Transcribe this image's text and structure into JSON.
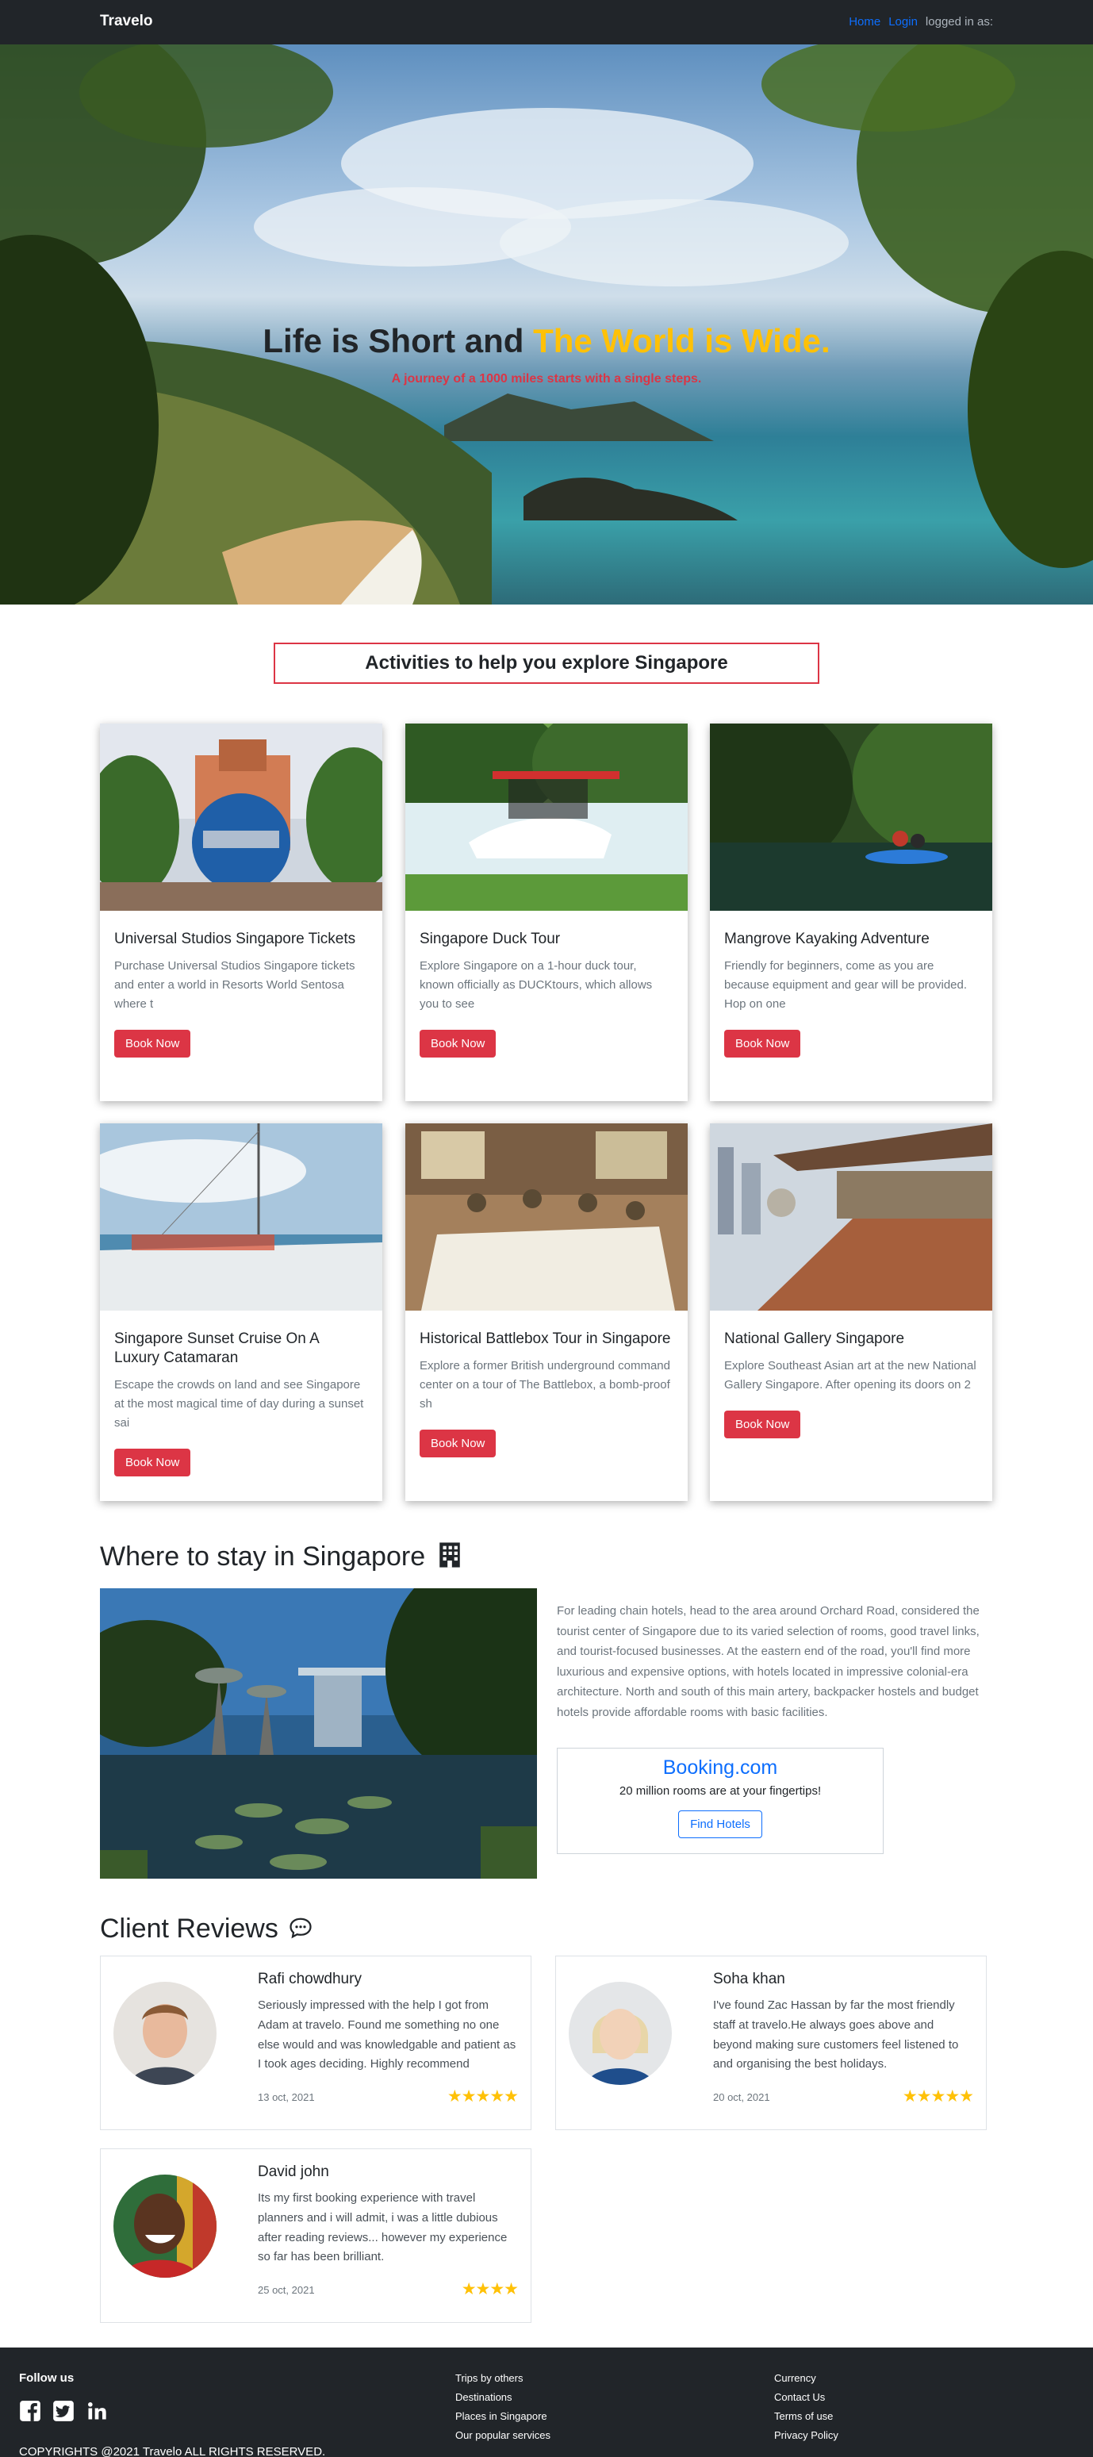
{
  "nav": {
    "brand": "Travelo",
    "links": [
      "Home",
      "Login"
    ],
    "status": "logged in as:"
  },
  "hero": {
    "title_part1": "Life is Short and ",
    "title_part2": "The World is Wide.",
    "subtitle": "A journey of a 1000 miles starts with a single steps."
  },
  "activities": {
    "heading": "Activities to help you explore Singapore",
    "cards": [
      {
        "title": "Universal Studios Singapore Tickets",
        "text": "Purchase Universal Studios Singapore tickets and enter a world in Resorts World Sentosa where t",
        "button": "Book Now",
        "image": "universal-globe"
      },
      {
        "title": "Singapore Duck Tour",
        "text": "Explore Singapore on a 1-hour duck tour, known officially as DUCKtours, which allows you to see",
        "button": "Book Now",
        "image": "duck-boat"
      },
      {
        "title": "Mangrove Kayaking Adventure",
        "text": "Friendly for beginners, come as you are because equipment and gear will be provided. Hop on one",
        "button": "Book Now",
        "image": "kayak"
      },
      {
        "title": "Singapore Sunset Cruise On A Luxury Catamaran",
        "text": "Escape the crowds on land and see Singapore at the most magical time of day during a sunset sai",
        "button": "Book Now",
        "image": "catamaran"
      },
      {
        "title": "Historical Battlebox Tour in Singapore",
        "text": "Explore a former British underground command center on a tour of The Battlebox, a bomb-proof sh",
        "button": "Book Now",
        "image": "battlebox"
      },
      {
        "title": "National Gallery Singapore",
        "text": "Explore Southeast Asian art at the new National Gallery Singapore. After opening its doors on 2",
        "button": "Book Now",
        "image": "gallery"
      }
    ]
  },
  "stay": {
    "heading": "Where to stay in Singapore",
    "icon": "building-icon",
    "description": "For leading chain hotels, head to the area around Orchard Road, considered the tourist center of Singapore due to its varied selection of rooms, good travel links, and tourist-focused businesses. At the eastern end of the road, you'll find more luxurious and expensive options, with hotels located in impressive colonial-era architecture. North and south of this main artery, backpacker hostels and budget hotels provide affordable rooms with basic facilities.",
    "booking": {
      "name": "Booking.com",
      "tagline": "20 million rooms are at your fingertips!",
      "button": "Find Hotels"
    }
  },
  "reviews": {
    "heading": "Client Reviews",
    "icon": "chat-icon",
    "items": [
      {
        "name": "Rafi chowdhury",
        "text": "Seriously impressed with the help I got from Adam at travelo. Found me something no one else would and was knowledgable and patient as I took ages deciding. Highly recommend",
        "date": "13 oct, 2021",
        "stars": "★★★★★",
        "rating": 5
      },
      {
        "name": "Soha khan",
        "text": "I've found Zac Hassan by far the most friendly staff at travelo.He always goes above and beyond making sure customers feel listened to and organising the best holidays.",
        "date": "20 oct, 2021",
        "stars": "★★★★★",
        "rating": 5
      },
      {
        "name": "David john",
        "text": "Its my first booking experience with travel planners and i will admit, i was a little dubious after reading reviews... however my experience so far has been brilliant.",
        "date": "25 oct, 2021",
        "stars": "★★★★",
        "rating": 4
      }
    ]
  },
  "footer": {
    "follow": "Follow us",
    "social_icons": [
      "facebook-icon",
      "twitter-icon",
      "linkedin-icon"
    ],
    "col1": [
      "Trips by others",
      "Destinations",
      "Places in Singapore",
      "Our popular services"
    ],
    "col2": [
      "Currency",
      "Contact Us",
      "Terms of use",
      "Privacy Policy"
    ],
    "copyright": "COPYRIGHTS @2021 Travelo ALL RIGHTS RESERVED."
  },
  "colors": {
    "navbar": "#212529",
    "accent_yellow": "#ffc107",
    "accent_red": "#dc3545",
    "link_blue": "#0d6efd"
  }
}
